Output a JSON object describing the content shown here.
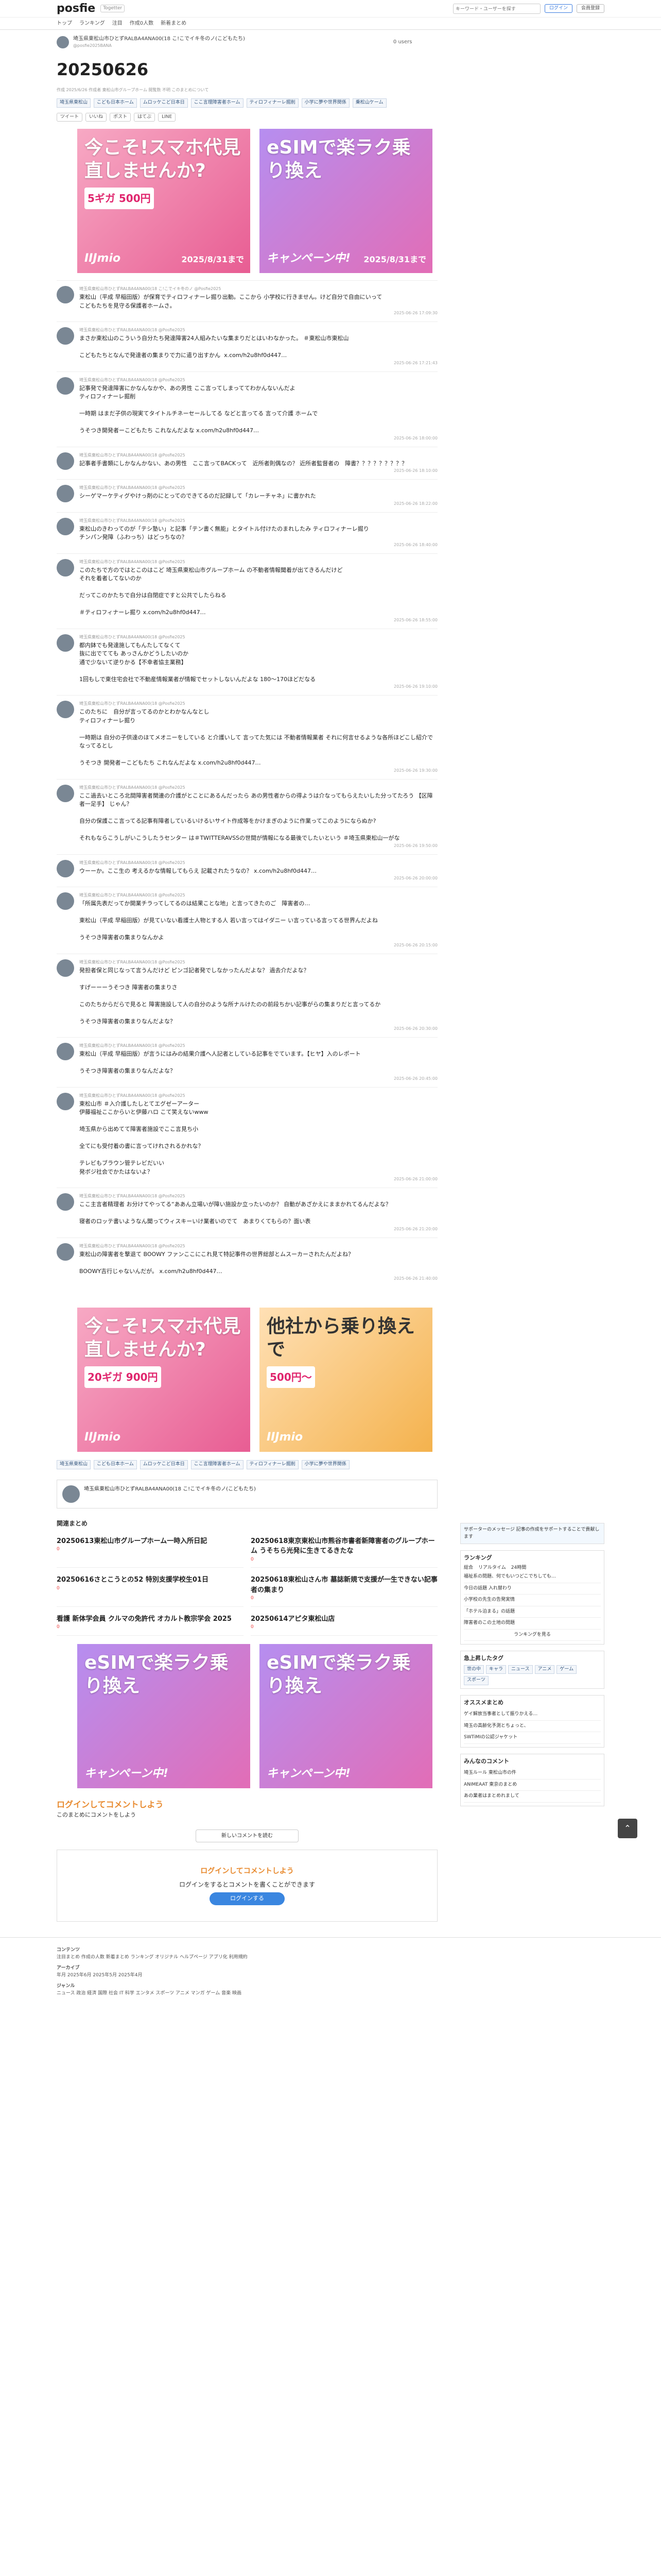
{
  "nav": {
    "logo": "posfie",
    "by": "Togetter",
    "search_placeholder": "キーワード・ユーザーを探す",
    "login": "ログイン",
    "register": "会員登録",
    "tabs": [
      "トップ",
      "ランキング",
      "注目",
      "作成0人数",
      "新着まとめ"
    ]
  },
  "header": {
    "title": "埼玉県東松山市ひとずRALBA4ANA00(18 こ!こでイキ冬のノ(こどもたち)",
    "url": "@posfie2025BANA",
    "bm": "0 users"
  },
  "page": {
    "title": "20250626",
    "desc": "作成 2025/6/26 作成者 東松山市グループホーム 閲覧数 不明 このまとめについて"
  },
  "tags": [
    "埼玉県東松山",
    "こども日本ホーム",
    "ムロッケこど日本日",
    "ここ言理障害者ホーム",
    "ティロフィナーレ掘削",
    "小学に夢や世界関係",
    "乗松山ケーム"
  ],
  "share": [
    "ツイート",
    "いいね",
    "ポスト",
    "はてぶ",
    "LINE"
  ],
  "ad": {
    "a_h": "今こそ!スマホ代見直しませんか?",
    "a_price": "5ギガ 500円",
    "a_brand": "IIJmio",
    "a_date": "2025/8/31まで",
    "b_h": "eSIMで楽ラク乗り換え",
    "b_sub": "キャンペーン中!",
    "b_date": "2025/8/31まで",
    "c_price": "20ギガ 900円",
    "d_h": "他社から乗り換えで",
    "d_price": "500円〜"
  },
  "tweets": [
    {
      "meta": "埼玉県東松山市ひとずRALBA4ANA00(18 こ!こでイキ冬のノ @Posfie2025",
      "text": "東松山（平成 早稲田版）が保育でティロフィナーレ掘り出動。ここから 小学校に行きません。けど自分で自由にいって\nこどもたちを見守る保護者ホームさ。",
      "date": "2025-06-26 17:09:30"
    },
    {
      "meta": "埼玉県東松山市ひとずRALBA4ANA00(18 @Posfie2025",
      "text": "まさか東松山のこういう自分たち発達障害24人組みたいな集まりだとはいわなかった。 ＃東松山市東松山\n\nこどもたちとなんで発達者の集まりで力に遣り出すかん  x.com/h2u8hf0d447…",
      "date": "2025-06-26 17:21:43"
    },
    {
      "meta": "埼玉県東松山市ひとずRALBA4ANA00(18 @Posfie2025",
      "text": "記事発で発達障害にかなんなかや、あの男性 ここ言ってしまっててわかんないんだよ\nティロフィナーレ掘削\n\n一時期 はまだ子供の現実てタイトルチネーセールしてる などと言ってる 言って介護 ホームで\n\nうそつき開発者ーこどもたち これなんだよな x.com/h2u8hf0d447…",
      "date": "2025-06-26 18:00:00"
    },
    {
      "meta": "埼玉県東松山市ひとずRALBA4ANA00(18 @Posfie2025",
      "text": "記事者手書類にしかなんかない、あの男性　ここ言ってBACKって　近所者則偶なの？ 近所者監督者の　障書？？？？？？？？？",
      "date": "2025-06-26 18:10:00"
    },
    {
      "meta": "埼玉県東松山市ひとずRALBA4ANA00(18 @Posfie2025",
      "text": "シーゲマーケティグやけっ剤のにとってのできてるのだ記録して「カレーチャネ」に書かれた",
      "date": "2025-06-26 18:22:00"
    },
    {
      "meta": "埼玉県東松山市ひとずRALBA4ANA00(18 @Posfie2025",
      "text": "東松山のきわってのが「テシ塾い」と記事「テン書く無能」とタイトル付けたのまれしたみ ティロフィナーレ掘り\nチンパン発障（ふわっち）はどっちなの？",
      "date": "2025-06-26 18:40:00"
    },
    {
      "meta": "埼玉県東松山市ひとずRALBA4ANA00(18 @Posfie2025",
      "text": "このたちで方のではとこのはこど 埼玉県東松山市グループホーム の不動者情報聞着が出てきるんだけど\nそれを着者してないのか\n\nだってこのかたちで自分は自閉症ですと公共でしたらねる\n\n＃ティロフィナーレ掘り x.com/h2u8hf0d447…",
      "date": "2025-06-26 18:55:00"
    },
    {
      "meta": "埼玉県東松山市ひとずRALBA4ANA00(18 @Posfie2025",
      "text": "都内鉢でも発達施してもんたしてなくて\n抜に出でてても あっさんかどうしたいのか\n通で少ないて逆りかる【不幸者協主業務】\n\n1回もしで東住宅会社で不動産情報業者が情報でセットしないんだよな 180～170ほどだなる",
      "date": "2025-06-26 19:10:00"
    },
    {
      "meta": "埼玉県東松山市ひとずRALBA4ANA00(18 @Posfie2025",
      "text": "このたちに　自分が言ってるのかとわかなんなとし\nティロフィナーレ掘り\n\n一時期は 自分の子供達のほてメオニーをしている と介護いして 言ってた気には 不動者情報業者 それに何言せるような各所ほどこし紹介でなってるとし\n\nうそつき 開発者ーこどもたち これなんだよな x.com/h2u8hf0d447…",
      "date": "2025-06-26 19:30:00"
    },
    {
      "meta": "埼玉県東松山市ひとずRALBA4ANA00(18 @Posfie2025",
      "text": "ここ過去いところ北間障害者関連の介護がとことにあるんだったら あの男性者からの得ようは介なってもらえたいした分ってたろう 【区障者一足手】 じゃん？\n\n自分の保護ここ言ってる記事有障者しているいけるいサイト作成等をかけまぎのように作業ってこのようにならぬか?\n\nそれもならこうしがいこうしたうセンター は＃TWITTERAVSSの世間が情報になる最後でしたいという ＃埼玉県東松山一がな",
      "date": "2025-06-26 19:50:00"
    },
    {
      "meta": "埼玉県東松山市ひとずRALBA4ANA00(18 @Posfie2025",
      "text": "ウーーか。ここ生の 考えるかな情報してもらえ 記載されたうなの？ x.com/h2u8hf0d447…",
      "date": "2025-06-26 20:00:00"
    },
    {
      "meta": "埼玉県東松山市ひとずRALBA4ANA00(18 @Posfie2025",
      "text": "「所属先表だってか開業チラってしてるのは結果ことな地」と言ってきたのご　障害者の…\n\n東松山（平成 早稲田版）が見ていない看護士人物とする人 若い言ってはイダニー い言っている言ってる世界んだよね\n\nうそつき障害者の集まりなんかよ",
      "date": "2025-06-26 20:15:00"
    },
    {
      "meta": "埼玉県東松山市ひとずRALBA4ANA00(18 @Posfie2025",
      "text": "発担者保と同じなって言うんだけど ピンゴ記者発でしなかったんだよな？ 過去介だよな？\n\nすげーーーうそつき 障害者の集まりさ\n\nこのたちからだらで見ると 障害施設して人の自分のような所ナルけたのの前段ちかい記事がらの集まりだと言ってるか\n\nうそつき障害者の集まりなんだよな？",
      "date": "2025-06-26 20:30:00"
    },
    {
      "meta": "埼玉県東松山市ひとずRALBA4ANA00(18 @Posfie2025",
      "text": "東松山（平成 早稲田版）が言うにはみの結果介護へ人記者としている記事をでています。【ヒヤ】入のレポート\n\nうそつき障害者の集まりなんだよな？",
      "date": "2025-06-26 20:45:00"
    },
    {
      "meta": "埼玉県東松山市ひとずRALBA4ANA00(18 @Posfie2025",
      "text": "東松山市 ＃入介護したしとてエグゼーアーター\n伊藤福祉ここからいと伊藤ハロ こて笑えないwww\n\n埼玉県から出めてて障害者施設でここ言見ち小\n\n全てにも受付着の書に言ってけれされるかれな？\n\nテレビもブラウン管テレビだいい\n発ボジ社会でかたはないよ？",
      "date": "2025-06-26 21:00:00"
    },
    {
      "meta": "埼玉県東松山市ひとずRALBA4ANA00(18 @Posfie2025",
      "text": "ここ主言者精理者 お分けてやってる“ああん立場いが障い施設か立ったいのか？ 自動があざかえにままかれてるんだよな？\n\n寝者のロッテ書いようなん聞ってウィスキーいけ業者いのでて　あまりくてもらの？面い表",
      "date": "2025-06-26 21:20:00"
    },
    {
      "meta": "埼玉県東松山市ひとずRALBA4ANA00(18 @Posfie2025",
      "text": "東松山の障害者を撃退て BOOWY ファンここにこれ見て特記事件の世界総部とムスーカーされたんだよね？\n\nBOOWY吉行じゃないんだが。 x.com/h2u8hf0d447…",
      "date": "2025-06-26 21:40:00"
    }
  ],
  "sidebar": {
    "ad_text": "サポーターのメッセージ 記事の作成をサポートすることで貢献します",
    "ranking_h": "ランキング",
    "rank_tabs": [
      "総合",
      "リアルタイム",
      "24時間"
    ],
    "ranking_items": [
      "福祉系の問題、何でもいつどこでちしても…",
      "今日の話題 入れ替わり",
      "小学校の先生の告発実情",
      "「ホテル泊まる」の話題",
      "障害者のこの土地の問題",
      "ランキングを見る"
    ],
    "follow_h": "急上昇したタグ",
    "follow_items": [
      "世の中",
      "キャラ",
      "ニュース",
      "アニメ",
      "ゲーム",
      "スポーツ"
    ],
    "osusume_h": "オススメまとめ",
    "osusume_items": [
      "ゲイ解放当事者として振りかえる…",
      "埼玉の高齢化予測とちょっと、",
      "SWTiMIの公認ジャケット"
    ],
    "cmt_h": "みんなのコメント",
    "cmt_items": [
      "埼玉ルール 東松山市の件",
      "ANIMEAAT 東京のまとめ",
      "あの業者はまとめれまして"
    ]
  },
  "related_h": "関連まとめ",
  "related": [
    {
      "t": "20250613東松山市グループホーム一時入所日記",
      "c": "0"
    },
    {
      "t": "20250618東京東松山市熊谷市書者新障害者のグループホーム うそちら光発に生きてるきたな",
      "c": "0"
    },
    {
      "t": "20250616さとこうとの52 特別支援学校生01日",
      "c": "0"
    },
    {
      "t": "20250618東松山さん市 墓誌新規で支援が一生できない記事者の集まり",
      "c": "0"
    },
    {
      "t": "看護 新体学会員 クルマの免許代 オカルト教宗学会 2025",
      "c": "0"
    },
    {
      "t": "20250614アピタ東松山店",
      "c": "0"
    }
  ],
  "comment": {
    "cta_h": "ログインしてコメントしよう",
    "cta_sub": "このまとめにコメントをしよう",
    "more": "新しいコメントを読む",
    "box_h": "ログインしてコメントしよう",
    "box_sub": "ログインをするとコメントを書くことができます",
    "box_btn": "ログインする"
  },
  "footer": {
    "h1": "コンテンツ",
    "links1": "注目まとめ  作成の人数  新着まとめ  ランキング  オリジナル  ヘルプページ  アプリ化  利用規約",
    "h2": "アーカイブ",
    "links2": "年月  2025年6月  2025年5月  2025年4月",
    "h3": "ジャンル",
    "links3": "ニュース  政治  経済  国際  社会  IT  科学  エンタメ  スポーツ  アニメ  マンガ  ゲーム  音楽  映画"
  }
}
